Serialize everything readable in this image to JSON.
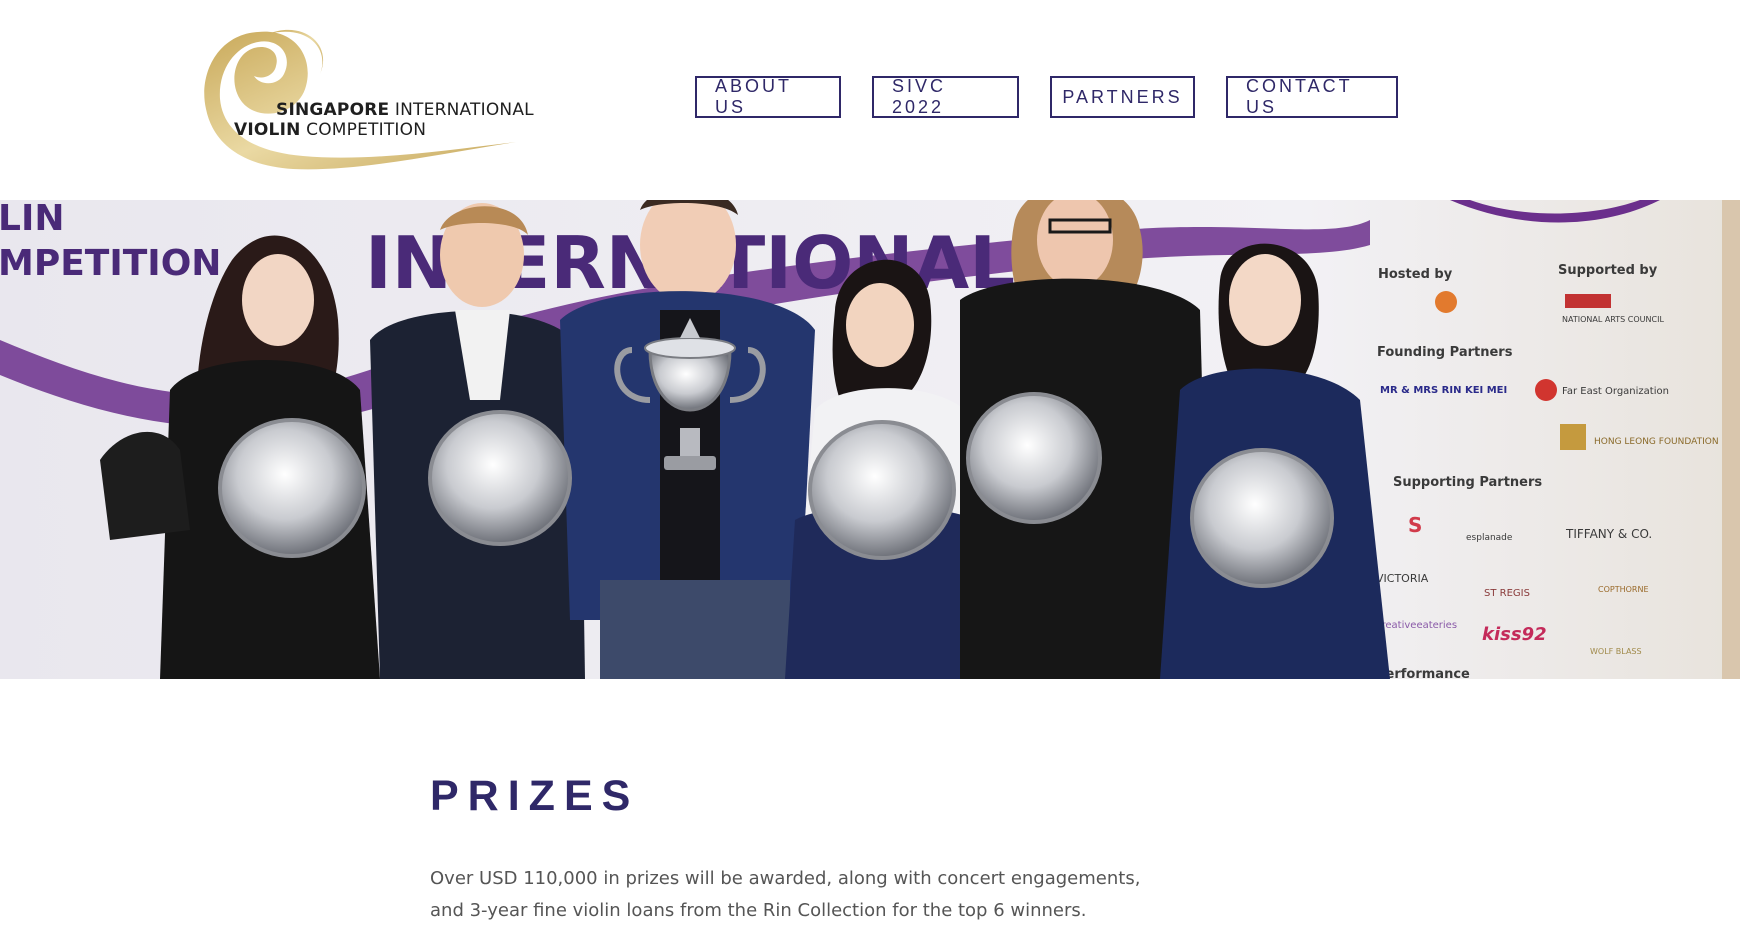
{
  "header": {
    "logo": {
      "line1_bold": "SINGAPORE",
      "line1_rest": " INTERNATIONAL",
      "line2_bold": "VIOLIN",
      "line2_rest": " COMPETITION",
      "icon": "gold-swirl-logo-icon"
    },
    "nav": [
      {
        "label": "ABOUT US"
      },
      {
        "label": "SIVC 2022"
      },
      {
        "label": "PARTNERS"
      },
      {
        "label": "CONTACT US"
      }
    ]
  },
  "hero": {
    "backdrop_text": {
      "left_partial_1": "LIN",
      "left_partial_2": "MPETITION",
      "center_big": "INTERNATIONAL"
    },
    "sponsor_board": {
      "hosted_by": "Hosted by",
      "supported_by": "Supported by",
      "founding_partners": "Founding Partners",
      "founding_name": "MR & MRS RIN KEI MEI",
      "supporting_partners": "Supporting Partners",
      "sponsor_1": "NATIONAL ARTS COUNCIL",
      "sponsor_2": "Far East Organization",
      "sponsor_3": "HONG LEONG FOUNDATION",
      "sponsor_4": "TIFFANY & CO.",
      "sponsor_5": "esplanade",
      "sponsor_6": "VICTORIA",
      "sponsor_7": "ST REGIS",
      "sponsor_8": "COPTHORNE",
      "sponsor_9": "kiss92",
      "sponsor_10": "WOLF BLASS",
      "sponsor_11": "creativeeateries",
      "performance": "Performance"
    },
    "colors": {
      "purple": "#5b2a86",
      "navy": "#1f2a55"
    }
  },
  "prizes": {
    "title": "PRIZES",
    "body": "Over USD 110,000 in prizes will be awarded, along with concert engagements, and 3-year fine violin loans from the Rin Collection for the top 6 winners."
  },
  "colors": {
    "brand": "#2f2868",
    "gold": "#d8bf7a"
  }
}
